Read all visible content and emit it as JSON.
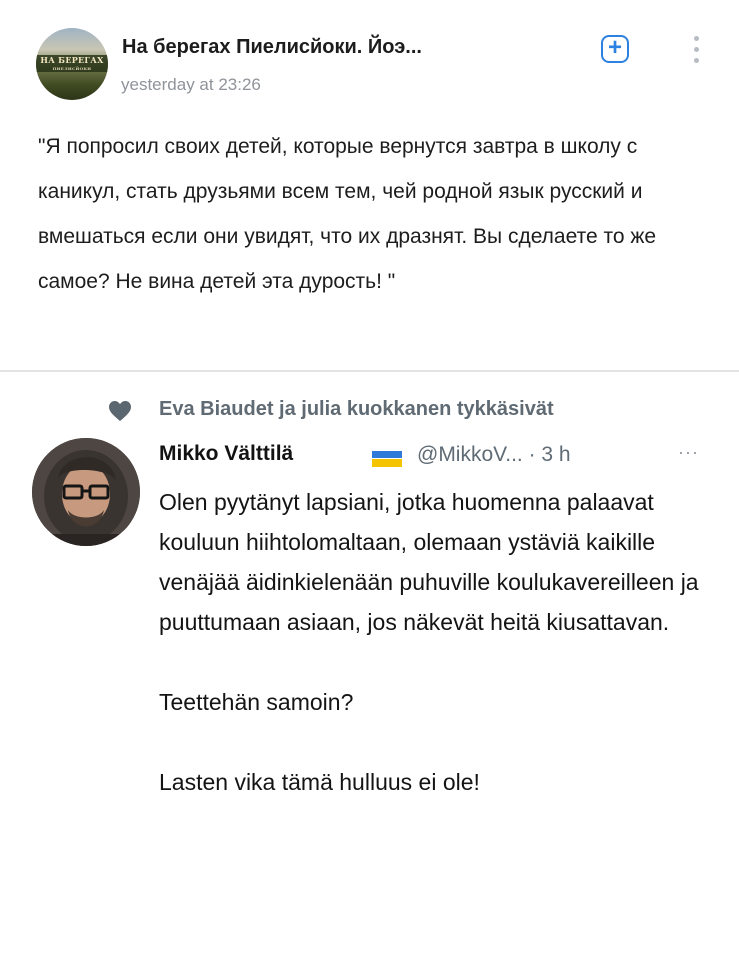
{
  "post": {
    "group_name": "На берегах Пиелисйоки. Йоэ...",
    "time": "yesterday at 23:26",
    "avatar_banner": "НА БЕРЕГАХ",
    "avatar_subline": "ПИЕЛИСЙОКИ",
    "subscribe_symbol": "+",
    "text": "\"Я попросил своих детей, которые вернутся завтра в школу с каникул, стать друзьями всем тем, чей родной язык русский и вмешаться если они увидят, что их дразнят. Вы сделаете то же самое? Не вина детей эта дурость! \""
  },
  "tweet": {
    "liked_by": "Eva Biaudet ja julia kuokkanen tykkäsivät",
    "author_name": "Mikko Välttilä",
    "handle_time": "@MikkoV... · 3 h",
    "more": "···",
    "paragraphs": [
      "Olen pyytänyt lapsiani, jotka huomenna palaavat kouluun hiihtolomaltaan, olemaan ystäviä kaikille venäjää äidinkielenään puhuville koulukavereilleen ja puuttumaan asiaan, jos näkevät heitä kiusattavan.",
      "Teettehän samoin?",
      "Lasten vika tämä hulluus ei ole!"
    ]
  },
  "colors": {
    "accent_blue": "#2d81e0",
    "meta_gray": "#8f939a",
    "liked_gray": "#5f6a73",
    "flag_blue": "#2f7ad8",
    "flag_yellow": "#f4c400"
  },
  "icons": {
    "subscribe": "plus-square-icon",
    "more": "vertical-dots-icon",
    "like": "heart-icon",
    "flag": "ukraine-flag-icon",
    "tweet_more": "horizontal-dots-icon"
  }
}
